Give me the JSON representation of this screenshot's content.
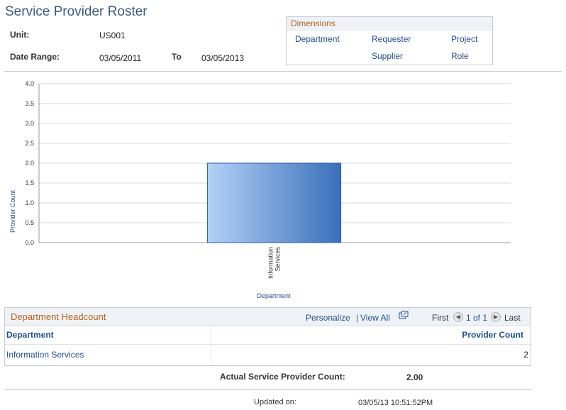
{
  "page": {
    "title": "Service Provider Roster"
  },
  "criteria": {
    "unit_label": "Unit:",
    "unit_value": "US001",
    "date_range_label": "Date Range:",
    "date_from": "03/05/2011",
    "to_label": "To",
    "date_to": "03/05/2013"
  },
  "dimensions": {
    "title": "Dimensions",
    "links": [
      "Department",
      "Requester",
      "Project",
      "Supplier",
      "Role"
    ]
  },
  "chart_data": {
    "type": "bar",
    "categories": [
      "Information Services"
    ],
    "values": [
      2.0
    ],
    "xlabel": "Department",
    "ylabel": "Provider Count",
    "ylim": [
      0,
      4.0
    ],
    "yticks": [
      "0.0",
      "0.5",
      "1.0",
      "1.5",
      "2.0",
      "2.5",
      "3.0",
      "3.5",
      "4.0"
    ],
    "grid": true,
    "colors": {
      "bar_start": "#b3d1f7",
      "bar_end": "#3a6fba"
    }
  },
  "headcount": {
    "title": "Department Headcount",
    "personalize": "Personalize",
    "view_all": "View All",
    "first": "First",
    "page_info": "1 of 1",
    "last": "Last",
    "columns": [
      "Department",
      "Provider Count"
    ],
    "rows": [
      {
        "department": "Information Services",
        "count": "2"
      }
    ]
  },
  "summary": {
    "actual_label": "Actual Service Provider Count:",
    "actual_value": "2.00",
    "updated_label": "Updated on:",
    "updated_value": "03/05/13 10:51:52PM"
  }
}
